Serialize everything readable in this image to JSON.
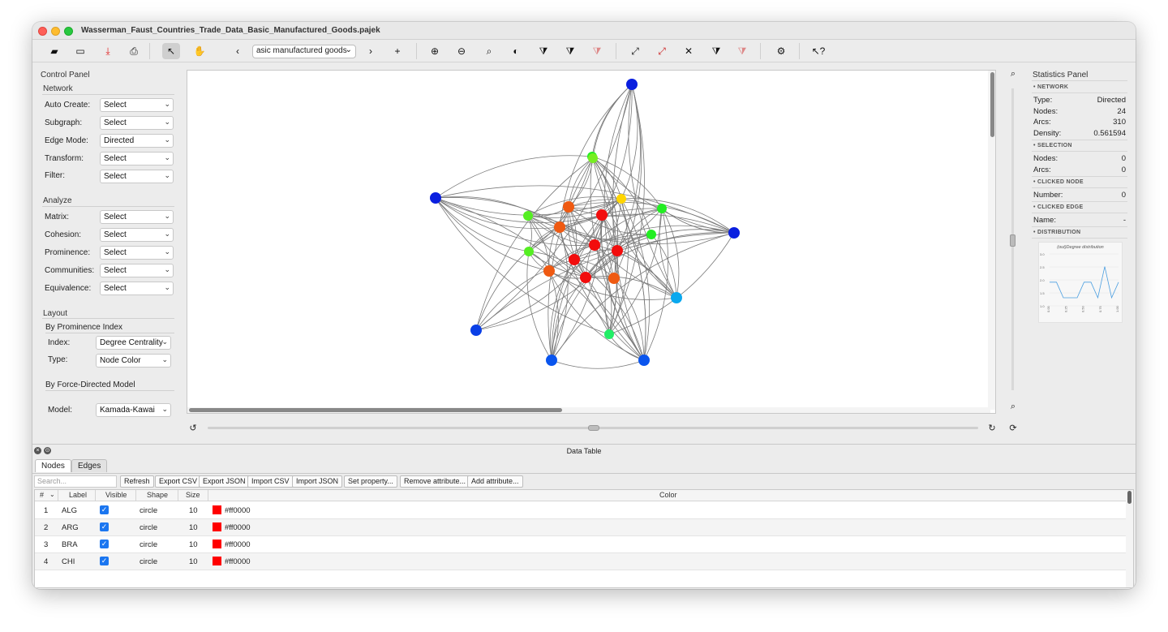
{
  "window": {
    "title": "Wasserman_Faust_Countries_Trade_Data_Basic_Manufactured_Goods.pajek"
  },
  "toolbar": {
    "relation_select": "asic manufactured goods",
    "prev_label": "‹",
    "next_label": "›",
    "add_label": "+"
  },
  "control_panel": {
    "title": "Control Panel",
    "network": {
      "heading": "Network",
      "rows": [
        {
          "label": "Auto Create:",
          "value": "Select"
        },
        {
          "label": "Subgraph:",
          "value": "Select"
        },
        {
          "label": "Edge Mode:",
          "value": "Directed"
        },
        {
          "label": "Transform:",
          "value": "Select"
        },
        {
          "label": "Filter:",
          "value": "Select"
        }
      ]
    },
    "analyze": {
      "heading": "Analyze",
      "rows": [
        {
          "label": "Matrix:",
          "value": "Select"
        },
        {
          "label": "Cohesion:",
          "value": "Select"
        },
        {
          "label": "Prominence:",
          "value": "Select"
        },
        {
          "label": "Communities:",
          "value": "Select"
        },
        {
          "label": "Equivalence:",
          "value": "Select"
        }
      ]
    },
    "layout": {
      "heading": "Layout",
      "prominence_heading": "By Prominence Index",
      "index_label": "Index:",
      "index_value": "Degree Centrality",
      "type_label": "Type:",
      "type_value": "Node Color",
      "force_heading": "By Force-Directed Model",
      "model_label": "Model:",
      "model_value": "Kamada-Kawai"
    }
  },
  "stats": {
    "title": "Statistics Panel",
    "network_heading": "• NETWORK",
    "type_label": "Type:",
    "type_value": "Directed",
    "nodes_label": "Nodes:",
    "nodes_value": "24",
    "arcs_label": "Arcs:",
    "arcs_value": "310",
    "density_label": "Density:",
    "density_value": "0.561594",
    "selection_heading": "• SELECTION",
    "sel_nodes_label": "Nodes:",
    "sel_nodes_value": "0",
    "sel_arcs_label": "Arcs:",
    "sel_arcs_value": "0",
    "clicked_node_heading": "• CLICKED NODE",
    "number_label": "Number:",
    "number_value": "0",
    "clicked_edge_heading": "• CLICKED EDGE",
    "name_label": "Name:",
    "name_value": "-",
    "distribution_heading": "• DISTRIBUTION",
    "distribution_title": "(out)Degree distribution"
  },
  "data_table": {
    "title": "Data Table",
    "tabs": [
      "Nodes",
      "Edges"
    ],
    "search_placeholder": "Search...",
    "buttons": [
      "Refresh",
      "Export CSV",
      "Export JSON",
      "Import CSV",
      "Import JSON",
      "Set property...",
      "Remove attribute...",
      "Add attribute..."
    ],
    "columns": {
      "num": "#",
      "label": "Label",
      "visible": "Visible",
      "shape": "Shape",
      "size": "Size",
      "color": "Color"
    },
    "rows": [
      {
        "num": "1",
        "label": "ALG",
        "shape": "circle",
        "size": "10",
        "color": "#ff0000"
      },
      {
        "num": "2",
        "label": "ARG",
        "shape": "circle",
        "size": "10",
        "color": "#ff0000"
      },
      {
        "num": "3",
        "label": "BRA",
        "shape": "circle",
        "size": "10",
        "color": "#ff0000"
      },
      {
        "num": "4",
        "label": "CHI",
        "shape": "circle",
        "size": "10",
        "color": "#ff0000"
      }
    ]
  },
  "colors": {
    "red": "#f20d0d",
    "orange": "#ef5a12",
    "yellow": "#ffd500",
    "green": "#22ee22",
    "blue": "#0a1fdf",
    "mid_blue": "#0a55ee",
    "light_blue": "#0aa8ee"
  },
  "graph": {
    "nodes": [
      {
        "label": "",
        "color": "#0a1fdf"
      },
      {
        "label": "",
        "color": "#0a1fdf"
      },
      {
        "label": "",
        "color": "#0a1fdf"
      },
      {
        "label": "",
        "color": "#0a3fe6"
      },
      {
        "label": "",
        "color": "#0a55ee"
      },
      {
        "label": "",
        "color": "#0a55ee"
      },
      {
        "label": "",
        "color": "#0aa8ee"
      },
      {
        "label": "",
        "color": "#22ee66"
      },
      {
        "label": "",
        "color": "#55ee22"
      },
      {
        "label": "",
        "color": "#55ee22"
      },
      {
        "label": "",
        "color": "#22ee22"
      },
      {
        "label": "",
        "color": "#22ee22"
      },
      {
        "label": "",
        "color": "#22ee22"
      },
      {
        "label": "",
        "color": "#77ee22"
      },
      {
        "label": "",
        "color": "#ffd500"
      },
      {
        "label": "",
        "color": "#ef5a12"
      },
      {
        "label": "",
        "color": "#ef5a12"
      },
      {
        "label": "",
        "color": "#ef5a12"
      },
      {
        "label": "",
        "color": "#ef5a12"
      },
      {
        "label": "",
        "color": "#f20d0d"
      },
      {
        "label": "",
        "color": "#f20d0d"
      },
      {
        "label": "",
        "color": "#f20d0d"
      },
      {
        "label": "",
        "color": "#f20d0d"
      },
      {
        "label": "",
        "color": "#f20d0d"
      }
    ]
  },
  "distribution": {
    "x": [
      "0.00",
      "0.25",
      "0.50",
      "0.75",
      "1.00"
    ],
    "y_ticks": [
      "3.0",
      "2.5",
      "2.0",
      "1.5",
      "1.0"
    ],
    "values": [
      2,
      2,
      1,
      1,
      1,
      2,
      2,
      1,
      3,
      1,
      2
    ]
  }
}
